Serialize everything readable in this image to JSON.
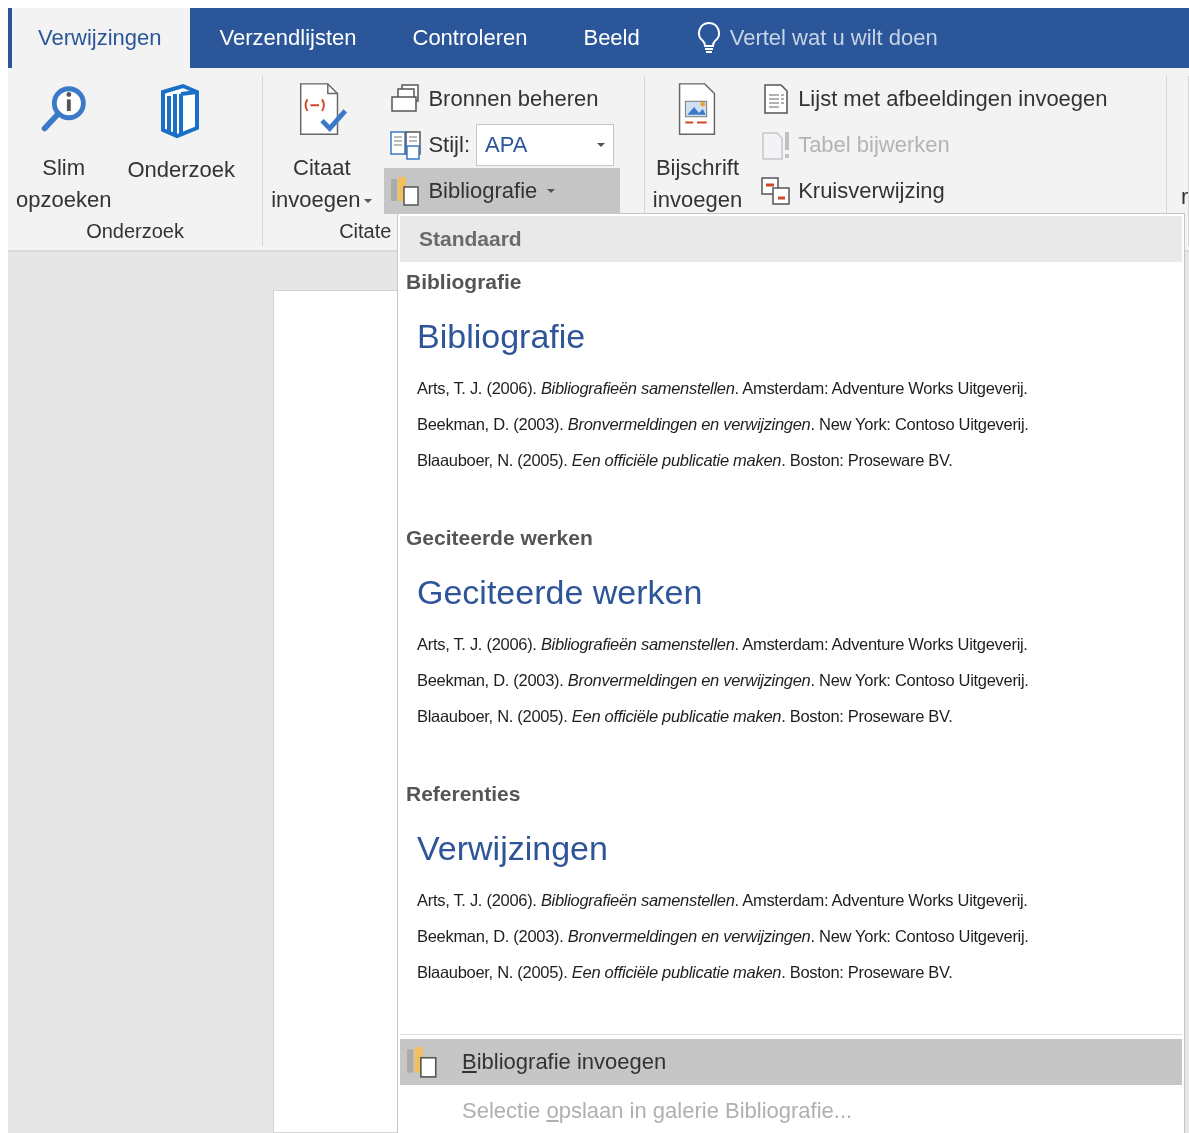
{
  "tabs": [
    {
      "label": "Verwijzingen",
      "selected": true
    },
    {
      "label": "Verzendlijsten",
      "selected": false
    },
    {
      "label": "Controleren",
      "selected": false
    },
    {
      "label": "Beeld",
      "selected": false
    }
  ],
  "tell_me": {
    "placeholder": "Vertel wat u wilt doen"
  },
  "ribbon": {
    "groups": [
      {
        "label": "Onderzoek",
        "items": [
          {
            "kind": "large",
            "label": "Slim\nopzoeken",
            "has_menu": false,
            "disabled": false,
            "expanded": false
          },
          {
            "kind": "large",
            "label": "Onderzoek",
            "has_menu": false,
            "disabled": false,
            "expanded": false
          }
        ]
      },
      {
        "label": "Citate",
        "items": [
          {
            "kind": "large",
            "label": "Citaat\ninvoegen",
            "has_menu": true,
            "disabled": false,
            "expanded": false
          },
          {
            "kind": "small",
            "label": "Bronnen beheren",
            "has_menu": false,
            "disabled": false,
            "expanded": false
          },
          {
            "kind": "combo",
            "label": "Stijl:",
            "value": "APA",
            "has_menu": true,
            "disabled": false,
            "expanded": false
          },
          {
            "kind": "small",
            "label": "Bibliografie",
            "has_menu": true,
            "disabled": false,
            "expanded": true
          }
        ]
      },
      {
        "items": [
          {
            "kind": "large",
            "label": "Bijschrift\ninvoegen",
            "has_menu": false,
            "disabled": false,
            "expanded": false
          },
          {
            "kind": "small",
            "label": "Lijst met afbeeldingen invoegen",
            "has_menu": false,
            "disabled": false,
            "expanded": false
          },
          {
            "kind": "small",
            "label": "Tabel bijwerken",
            "has_menu": false,
            "disabled": true,
            "expanded": false
          },
          {
            "kind": "small",
            "label": "Kruisverwijzing",
            "has_menu": false,
            "disabled": false,
            "expanded": false
          }
        ]
      },
      {
        "items": [
          {
            "kind": "clipped",
            "label": "r"
          }
        ]
      }
    ]
  },
  "menu": {
    "header": "Standaard",
    "sections": [
      {
        "title": "Bibliografie",
        "heading": "Bibliografie",
        "entries": [
          "Arts, T. J. (2006). *Bibliografieën samenstellen*. Amsterdam: Adventure Works Uitgeverij.",
          "Beekman, D. (2003). *Bronvermeldingen en verwijzingen*. New York: Contoso Uitgeverij.",
          "Blaauboer, N. (2005). *Een officiële publicatie maken*. Boston: Proseware BV."
        ]
      },
      {
        "title": "Geciteerde werken",
        "heading": "Geciteerde werken",
        "entries": [
          "Arts, T. J. (2006). *Bibliografieën samenstellen*. Amsterdam: Adventure Works Uitgeverij.",
          "Beekman, D. (2003). *Bronvermeldingen en verwijzingen*. New York: Contoso Uitgeverij.",
          "Blaauboer, N. (2005). *Een officiële publicatie maken*. Boston: Proseware BV."
        ]
      },
      {
        "title": "Referenties",
        "heading": "Verwijzingen",
        "entries": [
          "Arts, T. J. (2006). *Bibliografieën samenstellen*. Amsterdam: Adventure Works Uitgeverij.",
          "Beekman, D. (2003). *Bronvermeldingen en verwijzingen*. New York: Contoso Uitgeverij.",
          "Blaauboer, N. (2005). *Een officiële publicatie maken*. Boston: Proseware BV."
        ]
      }
    ],
    "commands": [
      {
        "access_key": "B",
        "after_key": "ibliografie invoegen",
        "has_icon": true,
        "selected": true,
        "disabled": false
      },
      {
        "before_key": "Selectie ",
        "access_key": "o",
        "after_key": "pslaan in galerie Bibliografie...",
        "has_icon": false,
        "selected": false,
        "disabled": true
      }
    ]
  }
}
